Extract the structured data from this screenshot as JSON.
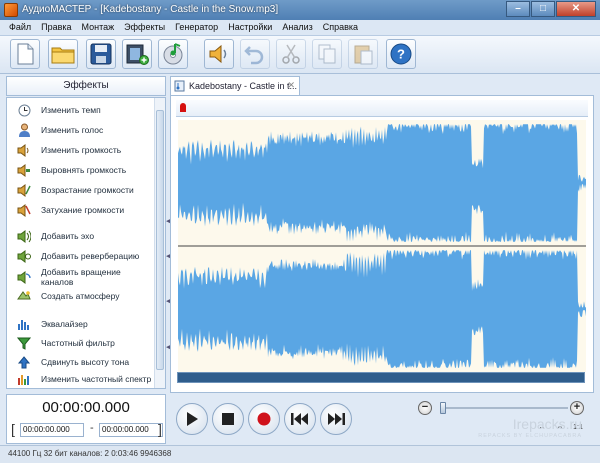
{
  "window": {
    "title": "АудиоМАСТЕР - [Kadebostany - Castle in the Snow.mp3]",
    "minimize": "–",
    "maximize": "□",
    "close": "✕"
  },
  "menu": [
    "Файл",
    "Правка",
    "Монтаж",
    "Эффекты",
    "Генератор",
    "Настройки",
    "Анализ",
    "Справка"
  ],
  "toolbar": [
    {
      "icon": "new-file-icon"
    },
    {
      "icon": "open-folder-icon"
    },
    {
      "icon": "save-icon"
    },
    {
      "icon": "add-video-icon"
    },
    {
      "icon": "add-music-cd-icon"
    },
    {
      "icon": "audio-player-icon"
    },
    {
      "icon": "undo-icon"
    },
    {
      "icon": "cut-icon"
    },
    {
      "icon": "copy-icon"
    },
    {
      "icon": "paste-icon"
    },
    {
      "icon": "help-icon"
    }
  ],
  "sidebar": {
    "header": "Эффекты",
    "items": [
      {
        "label": "Изменить темп",
        "icon": "clock-icon"
      },
      {
        "label": "Изменить голос",
        "icon": "person-icon"
      },
      {
        "label": "Изменить громкость",
        "icon": "volume-icon"
      },
      {
        "label": "Выровнять громкость",
        "icon": "level-volume-icon"
      },
      {
        "label": "Возрастание громкости",
        "icon": "volume-up-icon"
      },
      {
        "label": "Затухание громкости",
        "icon": "volume-down-icon"
      },
      {
        "label": "Добавить эхо",
        "icon": "echo-icon"
      },
      {
        "label": "Добавить реверберацию",
        "icon": "reverb-icon"
      },
      {
        "label": "Добавить вращение каналов",
        "icon": "rotate-channels-icon"
      },
      {
        "label": "Создать атмосферу",
        "icon": "atmosphere-icon"
      },
      {
        "label": "Эквалайзер",
        "icon": "equalizer-icon"
      },
      {
        "label": "Частотный фильтр",
        "icon": "filter-icon"
      },
      {
        "label": "Сдвинуть высоту тона",
        "icon": "pitch-icon"
      },
      {
        "label": "Изменить частотный спектр",
        "icon": "spectrum-icon"
      }
    ]
  },
  "tab": {
    "label": "Kadebostany - Castle in t...",
    "close": "✕"
  },
  "colors": {
    "wave": "#5aa6e4",
    "wave_bg": "#fdf9ec",
    "accent": "#2f5d8c"
  },
  "time": {
    "current": "00:00:00.000",
    "start": "00:00:00.000",
    "end": "00:00:00.000",
    "separator": "-"
  },
  "zoom": {
    "minus": "−",
    "plus": "+",
    "level": 0.02
  },
  "status": "44100 Гц  32 бит  каналов: 2   0:03:46 9946368",
  "watermark": {
    "main": "Irepacks.ru",
    "sub": "REPACKS BY ELCHUPACABRA"
  }
}
